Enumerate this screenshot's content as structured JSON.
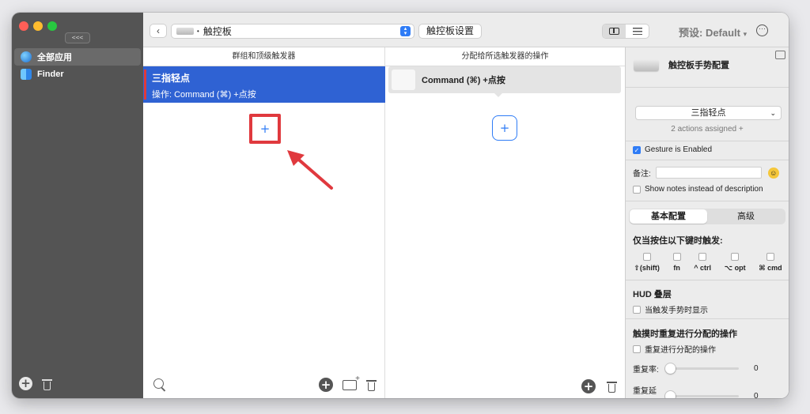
{
  "sidebar": {
    "collapse_label": "<<<",
    "items": [
      {
        "label": "全部应用",
        "icon": "globe-icon",
        "selected": true
      },
      {
        "label": "Finder",
        "icon": "finder-icon",
        "selected": false
      }
    ]
  },
  "toolbar": {
    "app_select_value": "触控板",
    "trackpad_settings_label": "触控板设置",
    "preset_label": "预设: Default",
    "preset_chevron": "▾",
    "more_label": "···"
  },
  "triggers_column": {
    "header": "群组和顶级触发器",
    "items": [
      {
        "title": "三指轻点",
        "subtitle": "操作: Command (⌘) +点按"
      }
    ],
    "add_label": "+"
  },
  "actions_column": {
    "header": "分配给所选触发器的操作",
    "items": [
      {
        "label": "Command (⌘) +点按"
      }
    ],
    "add_label": "+"
  },
  "inspector": {
    "title": "触控板手势配置",
    "gesture_select_value": "三指轻点",
    "actions_assigned": "2 actions assigned +",
    "gesture_enabled_label": "Gesture is Enabled",
    "gesture_enabled": true,
    "notes_label": "备注:",
    "show_notes_label": "Show notes instead of description",
    "tabs": [
      {
        "label": "基本配置",
        "selected": true
      },
      {
        "label": "高级",
        "selected": false
      }
    ],
    "modifier_title": "仅当按住以下键时触发:",
    "modifiers": [
      {
        "label": "⇧(shift)"
      },
      {
        "label": "fn"
      },
      {
        "label": "^ ctrl"
      },
      {
        "label": "⌥ opt"
      },
      {
        "label": "⌘ cmd"
      }
    ],
    "hud_title": "HUD 叠层",
    "hud_option": "当触发手势时显示",
    "repeat_title": "触摸时重复进行分配的操作",
    "repeat_option": "重复进行分配的操作",
    "repeat_rate_label": "重复率:",
    "repeat_rate_value": "0",
    "repeat_delay_label": "重复延迟:",
    "repeat_delay_value": "0"
  },
  "colors": {
    "accent": "#2f7cf6",
    "selection": "#2f62d3",
    "highlight_red": "#e0393e",
    "sidebar": "#545454"
  }
}
